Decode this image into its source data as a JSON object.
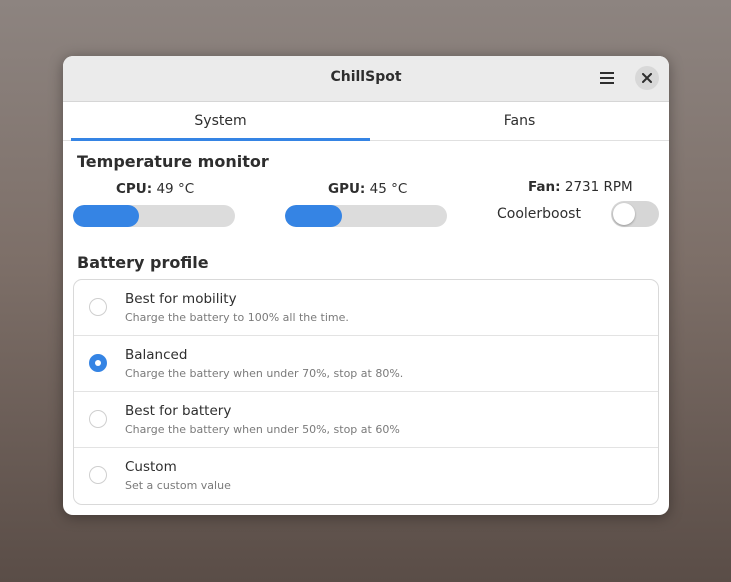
{
  "window": {
    "title": "ChillSpot"
  },
  "tabs": [
    {
      "label": "System",
      "active": true
    },
    {
      "label": "Fans",
      "active": false
    }
  ],
  "temperature": {
    "section_title": "Temperature monitor",
    "cpu_label": "CPU:",
    "cpu_value": "49 °C",
    "cpu_level_percent": 41,
    "gpu_label": "GPU:",
    "gpu_value": "45 °C",
    "gpu_level_percent": 35,
    "fan_label": "Fan:",
    "fan_value": "2731 RPM",
    "coolerboost_label": "Coolerboost",
    "coolerboost_on": false
  },
  "battery": {
    "section_title": "Battery profile",
    "options": [
      {
        "title": "Best for mobility",
        "subtitle": "Charge the battery to 100% all the time.",
        "selected": false
      },
      {
        "title": "Balanced",
        "subtitle": "Charge the battery when under 70%, stop at 80%.",
        "selected": true
      },
      {
        "title": "Best for battery",
        "subtitle": "Charge the battery when under 50%, stop at 60%",
        "selected": false
      },
      {
        "title": "Custom",
        "subtitle": "Set a custom value",
        "selected": false
      }
    ]
  },
  "colors": {
    "accent": "#3584e4",
    "track": "#dcdcdc"
  },
  "icons": {
    "menu": "hamburger-menu-icon",
    "close": "close-icon"
  }
}
